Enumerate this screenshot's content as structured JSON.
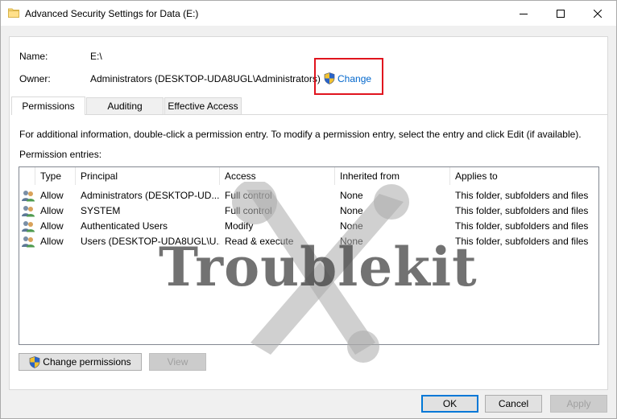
{
  "window": {
    "title": "Advanced Security Settings for Data (E:)",
    "minimize_icon": "minimize-icon",
    "maximize_icon": "maximize-icon",
    "close_icon": "close-icon"
  },
  "info": {
    "name_label": "Name:",
    "name_value": "E:\\",
    "owner_label": "Owner:",
    "owner_value": "Administrators (DESKTOP-UDA8UGL\\Administrators)",
    "change_link": "Change"
  },
  "tabs": [
    {
      "label": "Permissions",
      "active": true
    },
    {
      "label": "Auditing",
      "active": false
    },
    {
      "label": "Effective Access",
      "active": false
    }
  ],
  "description": "For additional information, double-click a permission entry. To modify a permission entry, select the entry and click Edit (if available).",
  "entries_label": "Permission entries:",
  "columns": [
    "Type",
    "Principal",
    "Access",
    "Inherited from",
    "Applies to"
  ],
  "rows": [
    [
      "Allow",
      "Administrators (DESKTOP-UD...",
      "Full control",
      "None",
      "This folder, subfolders and files"
    ],
    [
      "Allow",
      "SYSTEM",
      "Full control",
      "None",
      "This folder, subfolders and files"
    ],
    [
      "Allow",
      "Authenticated Users",
      "Modify",
      "None",
      "This folder, subfolders and files"
    ],
    [
      "Allow",
      "Users (DESKTOP-UDA8UGL\\U...",
      "Read & execute",
      "None",
      "This folder, subfolders and files"
    ]
  ],
  "buttons": {
    "change_permissions": "Change permissions",
    "view": "View",
    "ok": "OK",
    "cancel": "Cancel",
    "apply": "Apply"
  },
  "watermark": "Troublekit",
  "colors": {
    "link": "#0066cc",
    "highlight_box": "#e0141e",
    "default_button_border": "#0078d7"
  }
}
